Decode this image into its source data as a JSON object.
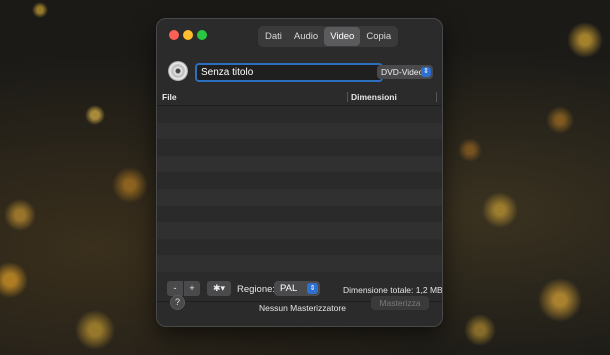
{
  "tabs": [
    "Dati",
    "Audio",
    "Video",
    "Copia"
  ],
  "active_tab": "Video",
  "disc_name": "Senza titolo",
  "disc_type": "DVD-Video",
  "table": {
    "col_file": "File",
    "col_size": "Dimensioni",
    "rows": []
  },
  "toolbar": {
    "minus": "-",
    "plus": "+",
    "gear": "✱▾",
    "region_label": "Regione:",
    "region_value": "PAL",
    "total_size": "Dimensione totale: 1,2 MB"
  },
  "footer": {
    "help": "?",
    "status": "Nessun Masterizzatore",
    "burn": "Masterizza"
  },
  "colors": {
    "accent": "#2f6fd0",
    "focus_ring": "#2d6fbe",
    "traffic_close": "#fe5f57",
    "traffic_min": "#febc2e",
    "traffic_max": "#28c840"
  }
}
